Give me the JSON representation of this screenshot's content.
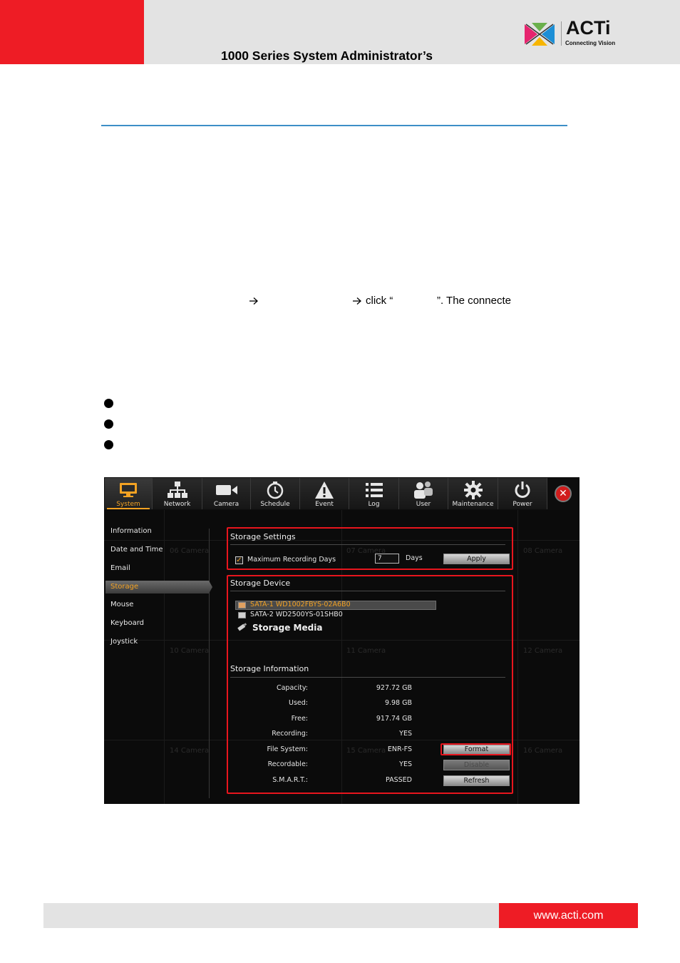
{
  "header": {
    "title": "1000 Series System Administrator’s",
    "logo_word": "ACTi",
    "logo_tagline": "Connecting Vision"
  },
  "body_text": {
    "arrow_1": "",
    "arrow_2": "",
    "click_text": "click “",
    "after_text": "”. The connecte"
  },
  "ui": {
    "tabs": [
      {
        "label": "System",
        "icon": "monitor-icon",
        "active": true
      },
      {
        "label": "Network",
        "icon": "network-icon"
      },
      {
        "label": "Camera",
        "icon": "camera-icon"
      },
      {
        "label": "Schedule",
        "icon": "clock-icon"
      },
      {
        "label": "Event",
        "icon": "warning-icon"
      },
      {
        "label": "Log",
        "icon": "list-icon"
      },
      {
        "label": "User",
        "icon": "users-icon"
      },
      {
        "label": "Maintenance",
        "icon": "gear-icon"
      },
      {
        "label": "Power",
        "icon": "power-icon"
      }
    ],
    "close_glyph": "✕",
    "side_menu": [
      "Information",
      "Date and Time",
      "Email",
      "Storage",
      "Mouse",
      "Keyboard",
      "Joystick"
    ],
    "background_cameras": [
      "06 Camera",
      "07 Camera",
      "08 Camera",
      "10 Camera",
      "11 Camera",
      "12 Camera",
      "14 Camera",
      "15 Camera",
      "16 Camera"
    ],
    "storage_settings": {
      "title": "Storage Settings",
      "max_days_label": "Maximum Recording Days",
      "max_days_checked": true,
      "max_days_value": "7",
      "days_unit": "Days",
      "apply_label": "Apply"
    },
    "storage_device": {
      "title": "Storage Device",
      "devices": [
        "SATA-1 WD1002FBYS-02A6B0",
        "SATA-2 WD2500YS-01SHB0"
      ],
      "media_label": "Storage Media"
    },
    "storage_information": {
      "title": "Storage Information",
      "rows": [
        {
          "key": "Capacity:",
          "value": "927.72 GB"
        },
        {
          "key": "Used:",
          "value": "9.98 GB"
        },
        {
          "key": "Free:",
          "value": "917.74 GB"
        },
        {
          "key": "Recording:",
          "value": "YES"
        },
        {
          "key": "File System:",
          "value": "ENR-FS"
        },
        {
          "key": "Recordable:",
          "value": "YES"
        },
        {
          "key": "S.M.A.R.T.:",
          "value": "PASSED"
        }
      ],
      "format_label": "Format",
      "disable_label": "Disable",
      "refresh_label": "Refresh"
    }
  },
  "footer": {
    "url": "www.acti.com"
  },
  "colors": {
    "brand_red": "#ee1c25",
    "accent_orange": "#f3a223",
    "rule_blue": "#3d8fc7",
    "highlight_red": "#e8151d"
  }
}
